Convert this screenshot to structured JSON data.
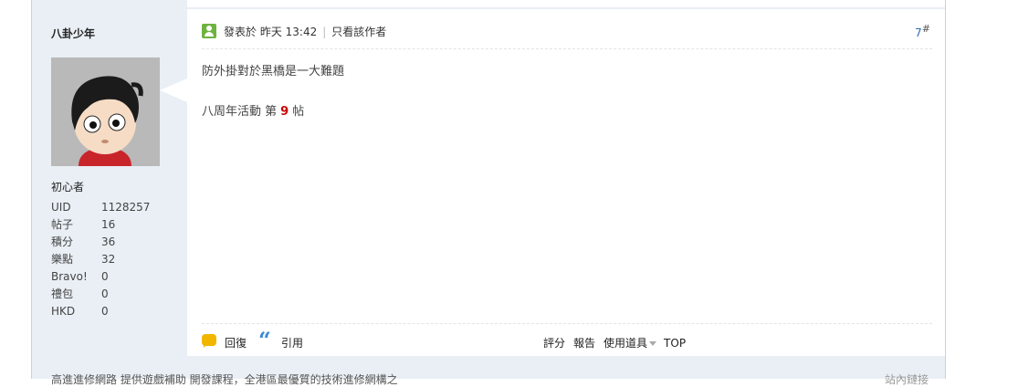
{
  "author": {
    "name": "八卦少年",
    "rank": "初心者",
    "stats": [
      {
        "key": "UID",
        "value": "1128257"
      },
      {
        "key": "帖子",
        "value": "16"
      },
      {
        "key": "積分",
        "value": "36"
      },
      {
        "key": "樂點",
        "value": "32"
      },
      {
        "key": "Bravo!",
        "value": "0"
      },
      {
        "key": "禮包",
        "value": "0"
      },
      {
        "key": "HKD",
        "value": "0"
      }
    ]
  },
  "post": {
    "posted_label": "發表於 昨天 13:42",
    "separator": "|",
    "only_author_label": "只看該作者",
    "floor_number": "7",
    "floor_symbol": "#",
    "body": "防外掛對於黑橋是一大難題",
    "event_prefix": "八周年活動 第",
    "event_number": "9",
    "event_suffix": "帖"
  },
  "footer": {
    "reply_label": "回復",
    "quote_label": "引用",
    "rate_label": "評分",
    "report_label": "報告",
    "tools_label": "使用道具",
    "top_label": "TOP"
  },
  "bottom": {
    "signature": "高進進修網路 提供遊戲補助 開發課程，全港區最優質的技術進修網構之",
    "right_text": "站內鏈接"
  },
  "icons": {
    "online": "online-user-icon",
    "reply": "speech-bubble-icon",
    "quote": "quote-icon",
    "dropdown": "chevron-down-icon"
  },
  "colors": {
    "frame_bg": "#e9eff5",
    "accent_blue": "#3b89d8",
    "event_red": "#cc0000",
    "reply_yellow": "#f2b500",
    "online_green": "#6db33f"
  }
}
